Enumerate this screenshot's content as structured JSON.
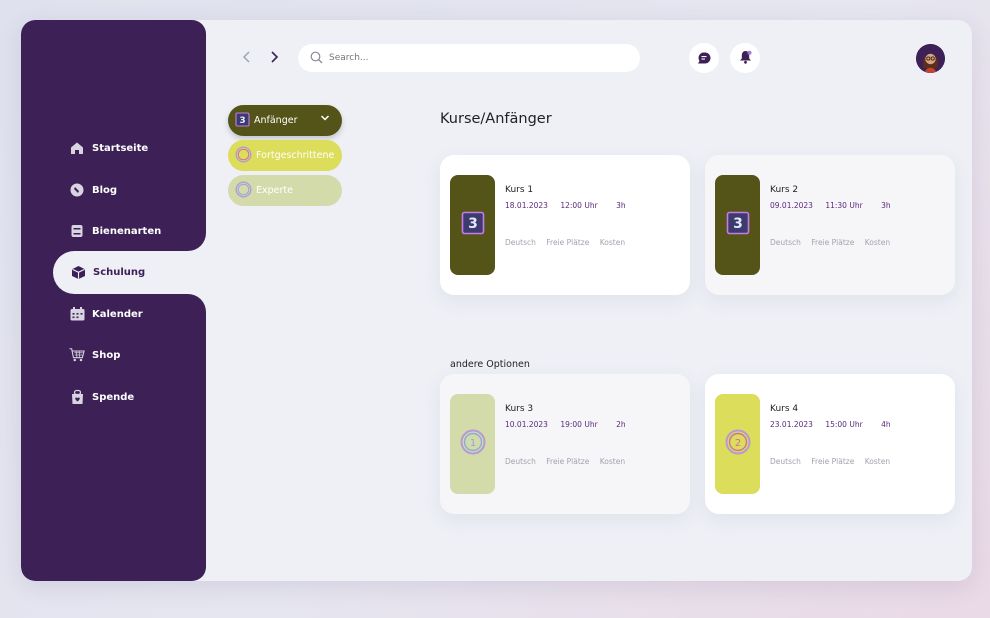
{
  "sidebar": {
    "items": [
      {
        "label": "Startseite",
        "icon": "home-icon"
      },
      {
        "label": "Blog",
        "icon": "blog-icon"
      },
      {
        "label": "Bienenarten",
        "icon": "book-icon"
      },
      {
        "label": "Schulung",
        "icon": "cube-icon",
        "active": true
      },
      {
        "label": "Kalender",
        "icon": "calendar-icon"
      },
      {
        "label": "Shop",
        "icon": "cart-icon"
      },
      {
        "label": "Spende",
        "icon": "donate-icon"
      }
    ]
  },
  "topbar": {
    "search_placeholder": "Search...",
    "back_icon": "chevron-left-icon",
    "forward_icon": "chevron-right-icon",
    "chat_icon": "chat-icon",
    "bell_icon": "bell-icon"
  },
  "levels": [
    {
      "label": "Anfänger",
      "badge": "3",
      "selected": true
    },
    {
      "label": "Fortgeschrittene"
    },
    {
      "label": "Experte"
    }
  ],
  "main": {
    "title": "Kurse/Anfänger",
    "other_options_label": "andere Optionen"
  },
  "courses": [
    {
      "name": "Kurs 1",
      "date": "18.01.2023",
      "time": "12:00 Uhr",
      "duration": "3h",
      "language": "Deutsch",
      "places": "Freie Plätze",
      "cost": "Kosten",
      "badge": "3"
    },
    {
      "name": "Kurs 2",
      "date": "09.01.2023",
      "time": "11:30 Uhr",
      "duration": "3h",
      "language": "Deutsch",
      "places": "Freie Plätze",
      "cost": "Kosten",
      "badge": "3"
    },
    {
      "name": "Kurs 3",
      "date": "10.01.2023",
      "time": "19:00 Uhr",
      "duration": "2h",
      "language": "Deutsch",
      "places": "Freie Plätze",
      "cost": "Kosten",
      "badge": "1"
    },
    {
      "name": "Kurs 4",
      "date": "23.01.2023",
      "time": "15:00 Uhr",
      "duration": "4h",
      "language": "Deutsch",
      "places": "Freie Plätze",
      "cost": "Kosten",
      "badge": "2"
    }
  ],
  "colors": {
    "sidebar": "#3d2156",
    "olive": "#545419",
    "yellow": "#dcdd5a",
    "pale_green": "#d4dbab",
    "accent_purple": "#5a2a7a"
  }
}
